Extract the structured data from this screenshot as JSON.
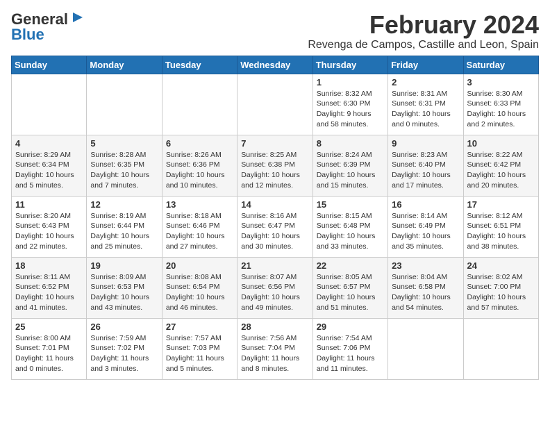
{
  "header": {
    "logo_general": "General",
    "logo_blue": "Blue",
    "month_title": "February 2024",
    "location": "Revenga de Campos, Castille and Leon, Spain"
  },
  "days_of_week": [
    "Sunday",
    "Monday",
    "Tuesday",
    "Wednesday",
    "Thursday",
    "Friday",
    "Saturday"
  ],
  "weeks": [
    [
      {
        "day": "",
        "info": ""
      },
      {
        "day": "",
        "info": ""
      },
      {
        "day": "",
        "info": ""
      },
      {
        "day": "",
        "info": ""
      },
      {
        "day": "1",
        "info": "Sunrise: 8:32 AM\nSunset: 6:30 PM\nDaylight: 9 hours\nand 58 minutes."
      },
      {
        "day": "2",
        "info": "Sunrise: 8:31 AM\nSunset: 6:31 PM\nDaylight: 10 hours\nand 0 minutes."
      },
      {
        "day": "3",
        "info": "Sunrise: 8:30 AM\nSunset: 6:33 PM\nDaylight: 10 hours\nand 2 minutes."
      }
    ],
    [
      {
        "day": "4",
        "info": "Sunrise: 8:29 AM\nSunset: 6:34 PM\nDaylight: 10 hours\nand 5 minutes."
      },
      {
        "day": "5",
        "info": "Sunrise: 8:28 AM\nSunset: 6:35 PM\nDaylight: 10 hours\nand 7 minutes."
      },
      {
        "day": "6",
        "info": "Sunrise: 8:26 AM\nSunset: 6:36 PM\nDaylight: 10 hours\nand 10 minutes."
      },
      {
        "day": "7",
        "info": "Sunrise: 8:25 AM\nSunset: 6:38 PM\nDaylight: 10 hours\nand 12 minutes."
      },
      {
        "day": "8",
        "info": "Sunrise: 8:24 AM\nSunset: 6:39 PM\nDaylight: 10 hours\nand 15 minutes."
      },
      {
        "day": "9",
        "info": "Sunrise: 8:23 AM\nSunset: 6:40 PM\nDaylight: 10 hours\nand 17 minutes."
      },
      {
        "day": "10",
        "info": "Sunrise: 8:22 AM\nSunset: 6:42 PM\nDaylight: 10 hours\nand 20 minutes."
      }
    ],
    [
      {
        "day": "11",
        "info": "Sunrise: 8:20 AM\nSunset: 6:43 PM\nDaylight: 10 hours\nand 22 minutes."
      },
      {
        "day": "12",
        "info": "Sunrise: 8:19 AM\nSunset: 6:44 PM\nDaylight: 10 hours\nand 25 minutes."
      },
      {
        "day": "13",
        "info": "Sunrise: 8:18 AM\nSunset: 6:46 PM\nDaylight: 10 hours\nand 27 minutes."
      },
      {
        "day": "14",
        "info": "Sunrise: 8:16 AM\nSunset: 6:47 PM\nDaylight: 10 hours\nand 30 minutes."
      },
      {
        "day": "15",
        "info": "Sunrise: 8:15 AM\nSunset: 6:48 PM\nDaylight: 10 hours\nand 33 minutes."
      },
      {
        "day": "16",
        "info": "Sunrise: 8:14 AM\nSunset: 6:49 PM\nDaylight: 10 hours\nand 35 minutes."
      },
      {
        "day": "17",
        "info": "Sunrise: 8:12 AM\nSunset: 6:51 PM\nDaylight: 10 hours\nand 38 minutes."
      }
    ],
    [
      {
        "day": "18",
        "info": "Sunrise: 8:11 AM\nSunset: 6:52 PM\nDaylight: 10 hours\nand 41 minutes."
      },
      {
        "day": "19",
        "info": "Sunrise: 8:09 AM\nSunset: 6:53 PM\nDaylight: 10 hours\nand 43 minutes."
      },
      {
        "day": "20",
        "info": "Sunrise: 8:08 AM\nSunset: 6:54 PM\nDaylight: 10 hours\nand 46 minutes."
      },
      {
        "day": "21",
        "info": "Sunrise: 8:07 AM\nSunset: 6:56 PM\nDaylight: 10 hours\nand 49 minutes."
      },
      {
        "day": "22",
        "info": "Sunrise: 8:05 AM\nSunset: 6:57 PM\nDaylight: 10 hours\nand 51 minutes."
      },
      {
        "day": "23",
        "info": "Sunrise: 8:04 AM\nSunset: 6:58 PM\nDaylight: 10 hours\nand 54 minutes."
      },
      {
        "day": "24",
        "info": "Sunrise: 8:02 AM\nSunset: 7:00 PM\nDaylight: 10 hours\nand 57 minutes."
      }
    ],
    [
      {
        "day": "25",
        "info": "Sunrise: 8:00 AM\nSunset: 7:01 PM\nDaylight: 11 hours\nand 0 minutes."
      },
      {
        "day": "26",
        "info": "Sunrise: 7:59 AM\nSunset: 7:02 PM\nDaylight: 11 hours\nand 3 minutes."
      },
      {
        "day": "27",
        "info": "Sunrise: 7:57 AM\nSunset: 7:03 PM\nDaylight: 11 hours\nand 5 minutes."
      },
      {
        "day": "28",
        "info": "Sunrise: 7:56 AM\nSunset: 7:04 PM\nDaylight: 11 hours\nand 8 minutes."
      },
      {
        "day": "29",
        "info": "Sunrise: 7:54 AM\nSunset: 7:06 PM\nDaylight: 11 hours\nand 11 minutes."
      },
      {
        "day": "",
        "info": ""
      },
      {
        "day": "",
        "info": ""
      }
    ]
  ]
}
